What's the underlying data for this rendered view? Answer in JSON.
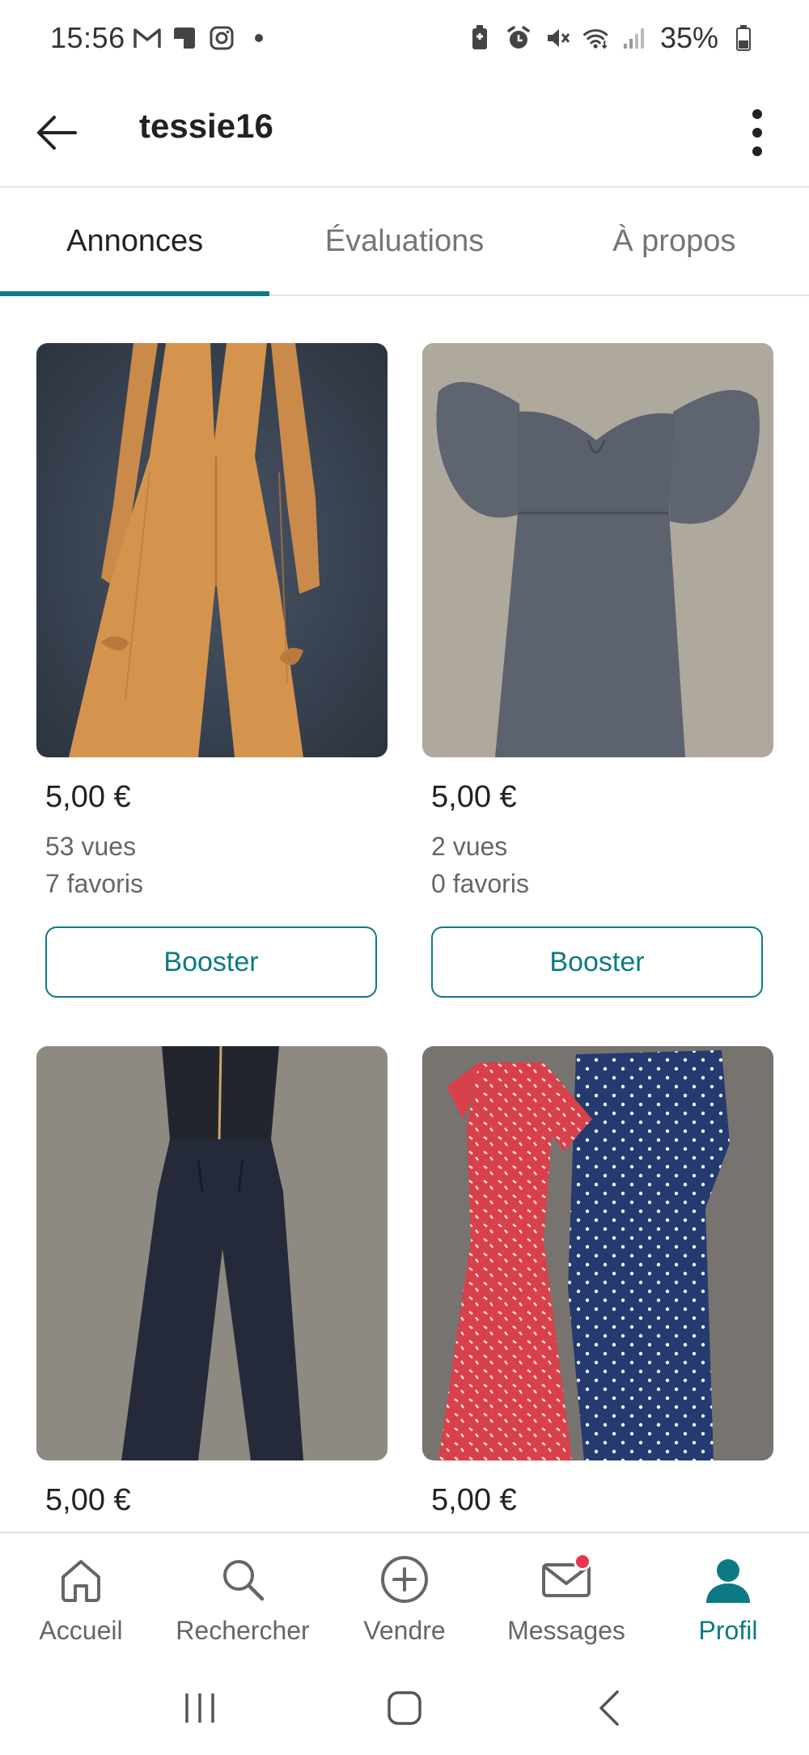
{
  "status_bar": {
    "time": "15:56",
    "battery_percent": "35%",
    "left_icons": [
      "gmail-icon",
      "app-icon",
      "instagram-icon",
      "dot-icon"
    ],
    "right_icons": [
      "battery-saver-icon",
      "alarm-icon",
      "mute-icon",
      "wifi-icon",
      "signal-icon",
      "battery-icon"
    ]
  },
  "header": {
    "username": "tessie16"
  },
  "tabs": [
    {
      "label": "Annonces",
      "active": true
    },
    {
      "label": "Évaluations",
      "active": false
    },
    {
      "label": "À propos",
      "active": false
    }
  ],
  "listings": [
    {
      "price": "5,00 €",
      "views": "53 vues",
      "favorites": "7 favoris",
      "button": "Booster",
      "photo": "orange jumpsuit"
    },
    {
      "price": "5,00 €",
      "views": "2 vues",
      "favorites": "0 favoris",
      "button": "Booster",
      "photo": "grey off-shoulder dress"
    },
    {
      "price": "5,00 €",
      "photo": "navy jumpsuit"
    },
    {
      "price": "5,00 €",
      "photo": "red and navy polka dot dresses"
    }
  ],
  "bottom_nav": [
    {
      "label": "Accueil",
      "icon": "home-icon",
      "active": false
    },
    {
      "label": "Rechercher",
      "icon": "search-icon",
      "active": false
    },
    {
      "label": "Vendre",
      "icon": "plus-circle-icon",
      "active": false
    },
    {
      "label": "Messages",
      "icon": "mail-icon",
      "active": false,
      "badge": true
    },
    {
      "label": "Profil",
      "icon": "person-icon",
      "active": true
    }
  ],
  "colors": {
    "accent": "#0c7a83",
    "badge": "#e8364a",
    "text_secondary": "#666666"
  }
}
